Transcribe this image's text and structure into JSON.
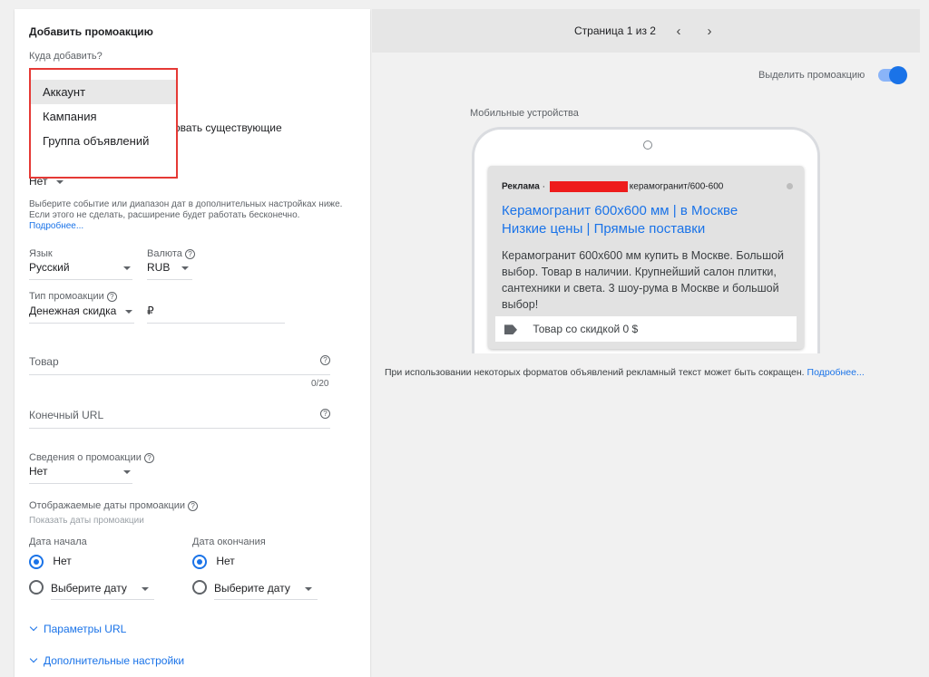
{
  "left": {
    "title": "Добавить промоакцию",
    "where_label": "Куда добавить?",
    "dropdown_items": [
      "Аккаунт",
      "Кампания",
      "Группа объявлений"
    ],
    "hidden_text": "овать существующие",
    "schedule_value": "Нет",
    "schedule_help": "Выберите событие или диапазон дат в дополнительных настройках ниже. Если этого не сделать, расширение будет работать бесконечно.",
    "more_link": "Подробнее...",
    "language_label": "Язык",
    "language_value": "Русский",
    "currency_label": "Валюта",
    "currency_value": "RUB",
    "promo_type_label": "Тип промоакции",
    "promo_type_value": "Денежная скидка",
    "currency_symbol": "₽",
    "item_placeholder": "Товар",
    "item_counter": "0/20",
    "final_url_placeholder": "Конечный URL",
    "details_label": "Сведения о промоакции",
    "details_value": "Нет",
    "dates_label": "Отображаемые даты промоакции",
    "dates_sub": "Показать даты промоакции",
    "start_label": "Дата начала",
    "end_label": "Дата окончания",
    "start_none": "Нет",
    "start_pick": "Выберите дату",
    "end_none": "Нет",
    "end_pick": "Выберите дату",
    "url_params": "Параметры URL",
    "advanced": "Дополнительные настройки"
  },
  "right": {
    "pager": "Страница 1 из 2",
    "prev": "‹",
    "next": "›",
    "highlight_label": "Выделить промоакцию",
    "device_label": "Мобильные устройства",
    "ad": {
      "badge": "Реклама",
      "separator": "·",
      "url_path": "керамогранит/600-600",
      "headline1": "Керамогранит 600x600 мм | в Москве",
      "headline2": "Низкие цены | Прямые поставки",
      "description": "Керамогранит 600x600 мм купить в Москве. Большой выбор. Товар в наличии. Крупнейший салон плитки, сантехники и света. 3 шоу-рума в Москве и большой выбор!",
      "promo_text": "Товар со скидкой 0 $"
    },
    "note": "При использовании некоторых форматов объявлений рекламный текст может быть сокращен.",
    "note_link": "Подробнее..."
  },
  "colors": {
    "accent": "#1a73e8",
    "highlight_border": "#e53935",
    "redaction": "#ee1c1c"
  }
}
